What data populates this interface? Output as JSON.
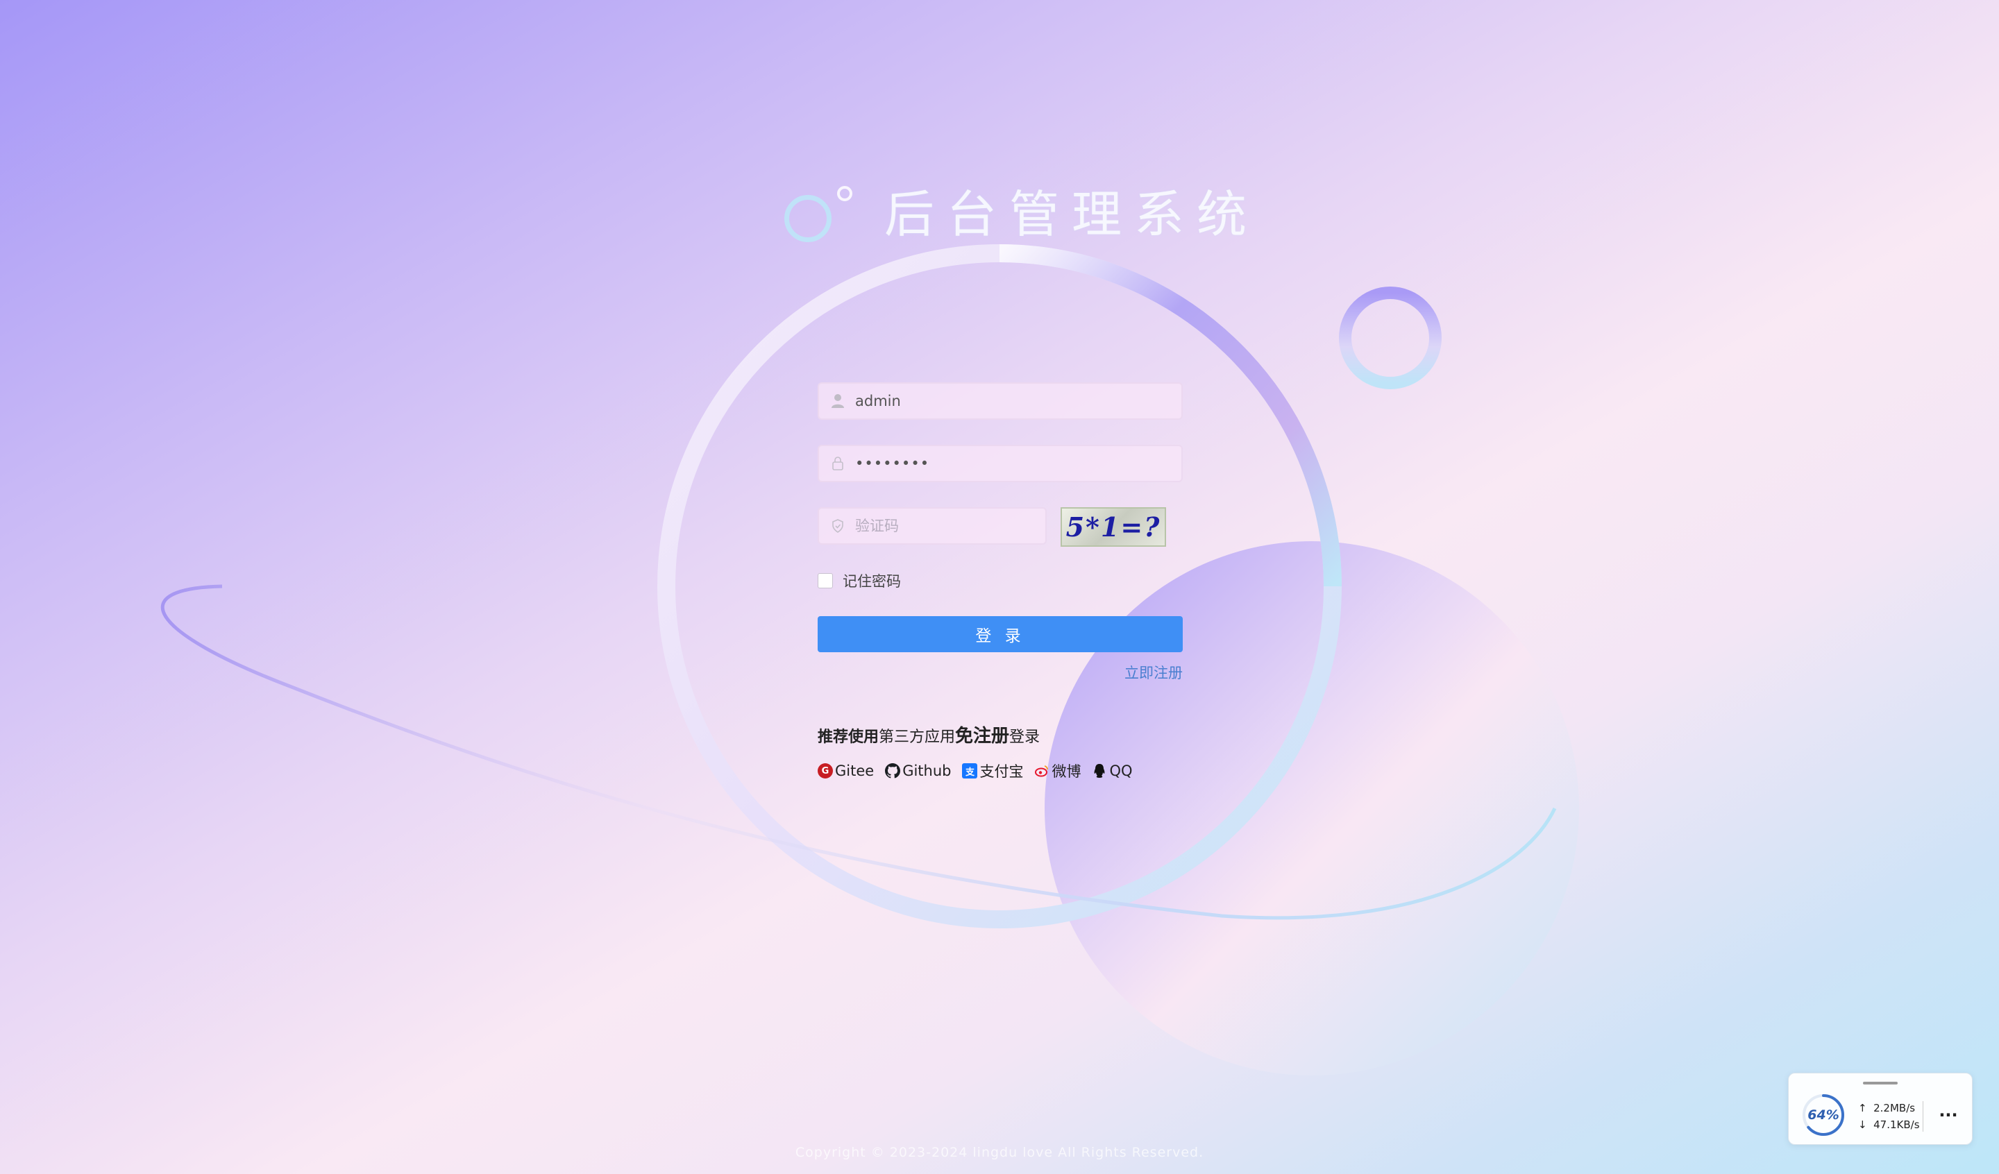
{
  "app": {
    "title": "后台管理系统"
  },
  "login_form": {
    "username_value": "admin",
    "password_value": "••••••••",
    "captcha_placeholder": "验证码",
    "captcha_image_text": "5*1=?",
    "remember_label": "记住密码",
    "login_button_label": "登 录",
    "register_link": "立即注册"
  },
  "third_party": {
    "recommend_prefix": "推荐使用",
    "recommend_middle": "第三方应用",
    "recommend_bold": "免注册",
    "recommend_suffix": "登录",
    "providers": [
      {
        "label": "Gitee",
        "icon": "gitee-icon",
        "color": "#c71d23"
      },
      {
        "label": "Github",
        "icon": "github-icon",
        "color": "#1b1f23"
      },
      {
        "label": "支付宝",
        "icon": "alipay-icon",
        "color": "#1677ff"
      },
      {
        "label": "微博",
        "icon": "weibo-icon",
        "color": "#e6162d"
      },
      {
        "label": "QQ",
        "icon": "qq-icon",
        "color": "#111111"
      }
    ]
  },
  "footer": {
    "copyright": "Copyright © 2023-2024 lingdu love All Rights Reserved."
  },
  "network_widget": {
    "percent_label": "64%",
    "percent_value": 0.64,
    "upload_speed": "2.2MB/s",
    "download_speed": "47.1KB/s",
    "more_label": "···"
  },
  "colors": {
    "primary_button": "#3f8ff5",
    "link": "#4a7fd0"
  }
}
